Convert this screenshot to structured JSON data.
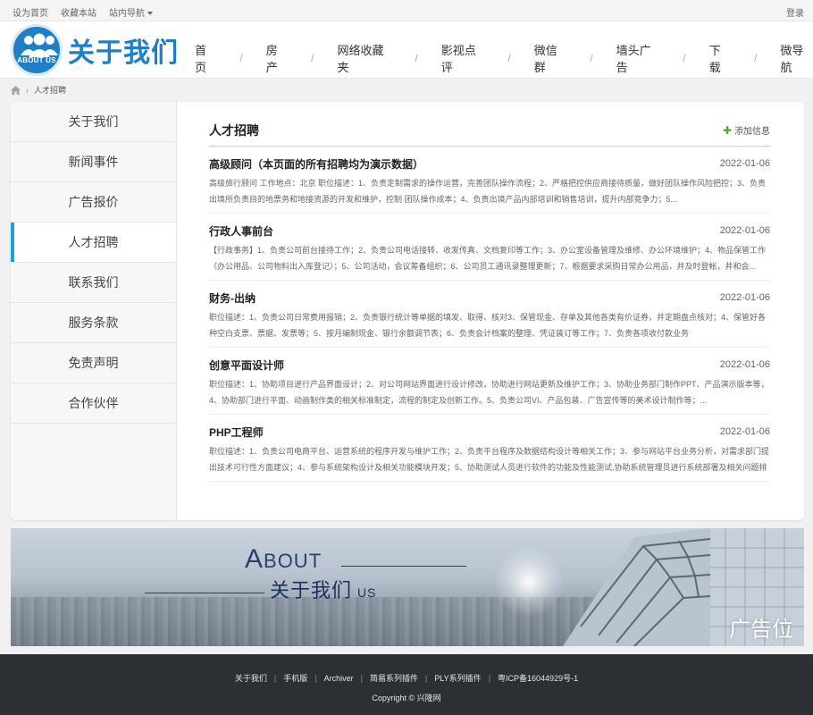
{
  "topbar": {
    "links": [
      "设为首页",
      "收藏本站",
      "站内导航"
    ],
    "login": "登录"
  },
  "header": {
    "logo_badge_text": "ABOUT US",
    "logo_title": "关于我们",
    "nav": [
      "首页",
      "房产",
      "网络收藏夹",
      "影视点评",
      "微信群",
      "墙头广告",
      "下载",
      "微导航"
    ]
  },
  "breadcrumb": {
    "current": "人才招聘"
  },
  "sidebar": {
    "items": [
      "关于我们",
      "新闻事件",
      "广告报价",
      "人才招聘",
      "联系我们",
      "服务条款",
      "免责声明",
      "合作伙伴"
    ],
    "active_index": 3
  },
  "content": {
    "title": "人才招聘",
    "add_label": "添加信息",
    "jobs": [
      {
        "title": "高级顾问（本页面的所有招聘均为演示数据）",
        "date": "2022-01-06",
        "desc": "高级旅行顾问 工作地点：北京 职位描述：1、负责定制需求的操作运营，完善团队操作流程；2、严格把控供应商接待质量，做好团队操作风险把控；3、负责出境所负责目的地票务和地接资源的开发和维护，控制 团队操作成本；4、负责出境产品内部培训和销售培训，提升内部竞争力；5..."
      },
      {
        "title": "行政人事前台",
        "date": "2022-01-06",
        "desc": "【行政事务】1、负责公司前台接待工作；2、负责公司电话接转、收发传真、文档复印等工作；3、办公室设备管理及维修、办公环境维护；4、物品保管工作（办公用品、公司物料出入库登记）；5、公司活动，会议筹备组织；6、公司员工通讯录整理更新；7、根据要求采购日常办公用品，并及时登帐，井和会..."
      },
      {
        "title": "财务-出纳",
        "date": "2022-01-06",
        "desc": "职位描述：1、负责公司日常费用报销；2、负责银行统计等单据的填发、取得、核对3、保管现金、存单及其他各类有价证券，并定期盘点核对；4、保管好各种空白支票、票据、发票等；5、按月编制现金、银行余额调节表；6、负责会计档案的整理、凭证装订等工作；7、负责各项收付款业务"
      },
      {
        "title": "创意平面设计师",
        "date": "2022-01-06",
        "desc": "职位描述：1、协助项目进行产品界面设计；2、对公司网站界面进行设计修改，协助进行网站更新及维护工作；3、协助业务部门制作PPT、产品演示版本等，4、协助部门进行平面、动画制作类的相关标准制定，流程的制定及创新工作。5、负责公司VI、产品包装、广告宣传等的美术设计制作等；..."
      },
      {
        "title": "PHP工程师",
        "date": "2022-01-06",
        "desc": "职位描述：1、负责公司电商平台、运营系统的程序开发与维护工作；2、负责平台程序及数据结构设计等相关工作；3、参与网站平台业务分析，对需求部门提出技术可行性方面建议；4、参与系统架构设计及相关功能模块开发；5、协助测试人员进行软件的功能及性能测试,协助系统管理员进行系统部署及相关问题排"
      }
    ]
  },
  "banner": {
    "about_a": "A",
    "about_rest": "BOUT",
    "about_cn": "关于我们",
    "about_us": "US",
    "ad_label": "广告位"
  },
  "footer": {
    "links": [
      "关于我们",
      "手机版",
      "Archiver",
      "简易系列插件",
      "PLY系列插件",
      "粤ICP备16044929号-1"
    ],
    "copyright": "Copyright © 兴隆网"
  }
}
